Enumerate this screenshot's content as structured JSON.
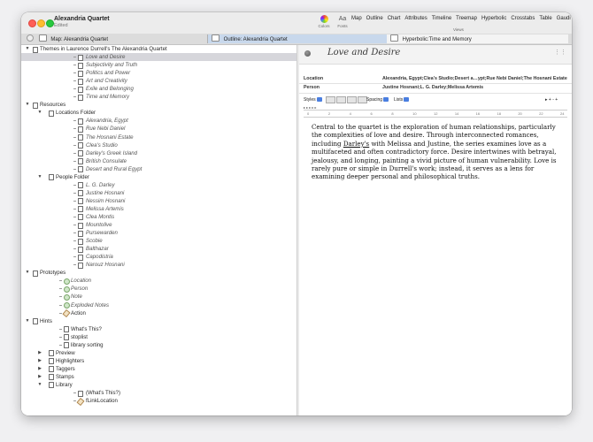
{
  "window": {
    "title": "Alexandria Quartet",
    "subtitle": "Edited"
  },
  "toolbar": {
    "colors_label": "Colors",
    "fonts_label": "Fonts",
    "fonts_glyph": "Aa",
    "views": [
      "Map",
      "Outline",
      "Chart",
      "Attributes",
      "Timeline",
      "Treemap",
      "Hyperbolic",
      "Crosstabs",
      "Table",
      "Gaudi"
    ],
    "views_caption": "Views"
  },
  "tabs": [
    {
      "label": "Map: Alexandria Quartet"
    },
    {
      "label": "Outline: Alexandria Quartet"
    },
    {
      "label": "Hyperbolic:Time and Memory"
    }
  ],
  "outline": {
    "rows": [
      {
        "label": "Themes in Laurence Durrell's The Alexandria Quartet",
        "style": "normal",
        "indent": 0,
        "tri": "▼",
        "icon": "note"
      },
      {
        "label": "Love and Desire",
        "style": "italic",
        "indent": 3,
        "tri": "",
        "icon": "note",
        "selected": true
      },
      {
        "label": "Subjectivity and Truth",
        "style": "italic",
        "indent": 3,
        "tri": "",
        "icon": "note"
      },
      {
        "label": "Politics and Power",
        "style": "italic",
        "indent": 3,
        "tri": "",
        "icon": "note"
      },
      {
        "label": "Art and Creativity",
        "style": "italic",
        "indent": 3,
        "tri": "",
        "icon": "note"
      },
      {
        "label": "Exile and Belonging",
        "style": "italic",
        "indent": 3,
        "tri": "",
        "icon": "note"
      },
      {
        "label": "Time and Memory",
        "style": "italic",
        "indent": 3,
        "tri": "",
        "icon": "note"
      },
      {
        "label": "Resources",
        "style": "normal",
        "indent": 0,
        "tri": "▼",
        "icon": "note"
      },
      {
        "label": "Locations Folder",
        "style": "normal",
        "indent": 1,
        "tri": "▼",
        "icon": "note"
      },
      {
        "label": "Alexandria, Egypt",
        "style": "italic",
        "indent": 3,
        "tri": "",
        "icon": "note"
      },
      {
        "label": "Rue Nebi Daniel",
        "style": "italic",
        "indent": 3,
        "tri": "",
        "icon": "note"
      },
      {
        "label": "The Hosnani Estate",
        "style": "italic",
        "indent": 3,
        "tri": "",
        "icon": "note"
      },
      {
        "label": "Clea's Studio",
        "style": "italic",
        "indent": 3,
        "tri": "",
        "icon": "note"
      },
      {
        "label": "Darley's Greek Island",
        "style": "italic",
        "indent": 3,
        "tri": "",
        "icon": "note"
      },
      {
        "label": "British Consulate",
        "style": "italic",
        "indent": 3,
        "tri": "",
        "icon": "note"
      },
      {
        "label": "Desert and Rural Egypt",
        "style": "italic",
        "indent": 3,
        "tri": "",
        "icon": "note"
      },
      {
        "label": "People Folder",
        "style": "normal",
        "indent": 1,
        "tri": "▼",
        "icon": "note"
      },
      {
        "label": "L. G. Darley",
        "style": "italic",
        "indent": 3,
        "tri": "",
        "icon": "note"
      },
      {
        "label": "Justine Hosnani",
        "style": "italic",
        "indent": 3,
        "tri": "",
        "icon": "note"
      },
      {
        "label": "Nessim Hosnani",
        "style": "italic",
        "indent": 3,
        "tri": "",
        "icon": "note"
      },
      {
        "label": "Melissa Artemis",
        "style": "italic",
        "indent": 3,
        "tri": "",
        "icon": "note"
      },
      {
        "label": "Clea Montis",
        "style": "italic",
        "indent": 3,
        "tri": "",
        "icon": "note"
      },
      {
        "label": "Mountolive",
        "style": "italic",
        "indent": 3,
        "tri": "",
        "icon": "note"
      },
      {
        "label": "Pursewarden",
        "style": "italic",
        "indent": 3,
        "tri": "",
        "icon": "note"
      },
      {
        "label": "Scobie",
        "style": "italic",
        "indent": 3,
        "tri": "",
        "icon": "note"
      },
      {
        "label": "Balthazar",
        "style": "italic",
        "indent": 3,
        "tri": "",
        "icon": "note"
      },
      {
        "label": "Capodistria",
        "style": "italic",
        "indent": 3,
        "tri": "",
        "icon": "note"
      },
      {
        "label": "Narouz Hosnani",
        "style": "italic",
        "indent": 3,
        "tri": "",
        "icon": "note"
      },
      {
        "label": "Prototypes",
        "style": "normal",
        "indent": 0,
        "tri": "▼",
        "icon": "note"
      },
      {
        "label": "Location",
        "style": "italic",
        "indent": 2,
        "tri": "",
        "icon": "proto"
      },
      {
        "label": "Person",
        "style": "italic",
        "indent": 2,
        "tri": "",
        "icon": "proto"
      },
      {
        "label": "Note",
        "style": "italic",
        "indent": 2,
        "tri": "",
        "icon": "proto"
      },
      {
        "label": "Exploded Notes",
        "style": "italic",
        "indent": 2,
        "tri": "",
        "icon": "proto"
      },
      {
        "label": "Action",
        "style": "normal",
        "indent": 2,
        "tri": "",
        "icon": "action"
      },
      {
        "label": "Hints",
        "style": "normal",
        "indent": 0,
        "tri": "▼",
        "icon": "note"
      },
      {
        "label": "What's This?",
        "style": "normal",
        "indent": 2,
        "tri": "",
        "icon": "note"
      },
      {
        "label": "stoplist",
        "style": "normal",
        "indent": 2,
        "tri": "",
        "icon": "note"
      },
      {
        "label": "library sorting",
        "style": "normal",
        "indent": 2,
        "tri": "",
        "icon": "note"
      },
      {
        "label": "Preview",
        "style": "normal",
        "indent": 1,
        "tri": "▶",
        "icon": "note"
      },
      {
        "label": "Highlighters",
        "style": "normal",
        "indent": 1,
        "tri": "▶",
        "icon": "note"
      },
      {
        "label": "Taggers",
        "style": "normal",
        "indent": 1,
        "tri": "▶",
        "icon": "note"
      },
      {
        "label": "Stamps",
        "style": "normal",
        "indent": 1,
        "tri": "▶",
        "icon": "note"
      },
      {
        "label": "Library",
        "style": "normal",
        "indent": 1,
        "tri": "▼",
        "icon": "note"
      },
      {
        "label": "(What's This?)",
        "style": "normal",
        "indent": 3,
        "tri": "",
        "icon": "note"
      },
      {
        "label": "fLinkLocation",
        "style": "normal",
        "indent": 3,
        "tri": "",
        "icon": "action"
      }
    ]
  },
  "note": {
    "title": "Love and Desire",
    "attributes": [
      {
        "key": "Location",
        "value": "Alexandria, Egypt;Clea's Studio;Desert a…ypt;Rue Nebi Daniel;The Hosnani Estate"
      },
      {
        "key": "Person",
        "value": "Justine Hosnani;L. G. Darley;Melissa Artemis"
      }
    ],
    "tools": {
      "styles_label": "Styles",
      "spacing_label": "Spacing",
      "lists_label": "Lists"
    },
    "ruler_ticks": [
      "0",
      "2",
      "4",
      "6",
      "8",
      "10",
      "12",
      "14",
      "16",
      "18",
      "20",
      "22",
      "24"
    ],
    "body_before": "Central to the quartet is the exploration of human relationships, particularly the complexities of love and desire. Through interconnected romances, including ",
    "body_link": "Darley's",
    "body_after": " with Melissa and Justine, the series examines love as a multifaceted and often contradictory force. Desire intertwines with betrayal, jealousy, and longing, painting a vivid picture of human vulnerability. Love is rarely pure or simple in Durrell's work; instead, it serves as a lens for examining deeper personal and philosophical truths."
  }
}
